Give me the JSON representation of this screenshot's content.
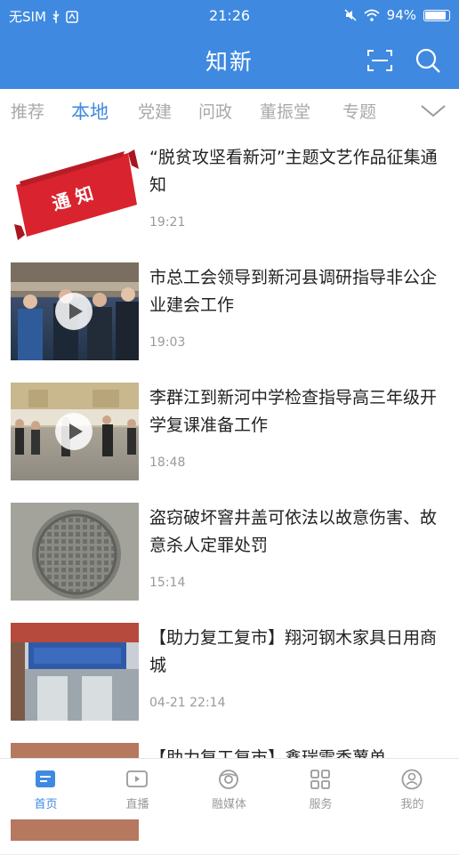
{
  "status_bar": {
    "carrier": "无SIM",
    "time": "21:26",
    "battery": "94%",
    "battery_level": 0.94
  },
  "app_bar": {
    "title": "知新"
  },
  "tabs": [
    {
      "label": "推荐",
      "active": false
    },
    {
      "label": "本地",
      "active": true
    },
    {
      "label": "党建",
      "active": false
    },
    {
      "label": "问政",
      "active": false
    },
    {
      "label": "董振堂",
      "active": false
    },
    {
      "label": "专题",
      "active": false
    }
  ],
  "news": [
    {
      "title": "“脱贫攻坚看新河”主题文艺作品征集通知",
      "time": "19:21",
      "thumb_text": "通 知",
      "video": false
    },
    {
      "title": "市总工会领导到新河县调研指导非公企业建会工作",
      "time": "19:03",
      "video": true
    },
    {
      "title": "李群江到新河中学检查指导高三年级开学复课准备工作",
      "time": "18:48",
      "video": true
    },
    {
      "title": "盗窃破坏窨井盖可依法以故意伤害、故意杀人定罪处罚",
      "time": "15:14",
      "video": false
    },
    {
      "title": "【助力复工复市】翔河钢木家具日用商城",
      "time": "04-21 22:14",
      "video": false
    },
    {
      "title": "【助力复工复市】鑫瑞雪香薯单",
      "time": "",
      "video": false
    }
  ],
  "bottom_nav": [
    {
      "label": "首页",
      "icon": "home-icon",
      "active": true
    },
    {
      "label": "直播",
      "icon": "live-tv-icon",
      "active": false
    },
    {
      "label": "融媒体",
      "icon": "media-icon",
      "active": false
    },
    {
      "label": "服务",
      "icon": "grid-icon",
      "active": false
    },
    {
      "label": "我的",
      "icon": "profile-icon",
      "active": false
    }
  ],
  "colors": {
    "accent": "#3f8ae0",
    "text": "#222222",
    "muted": "#9a9a9a",
    "notice_red": "#d9232e"
  }
}
